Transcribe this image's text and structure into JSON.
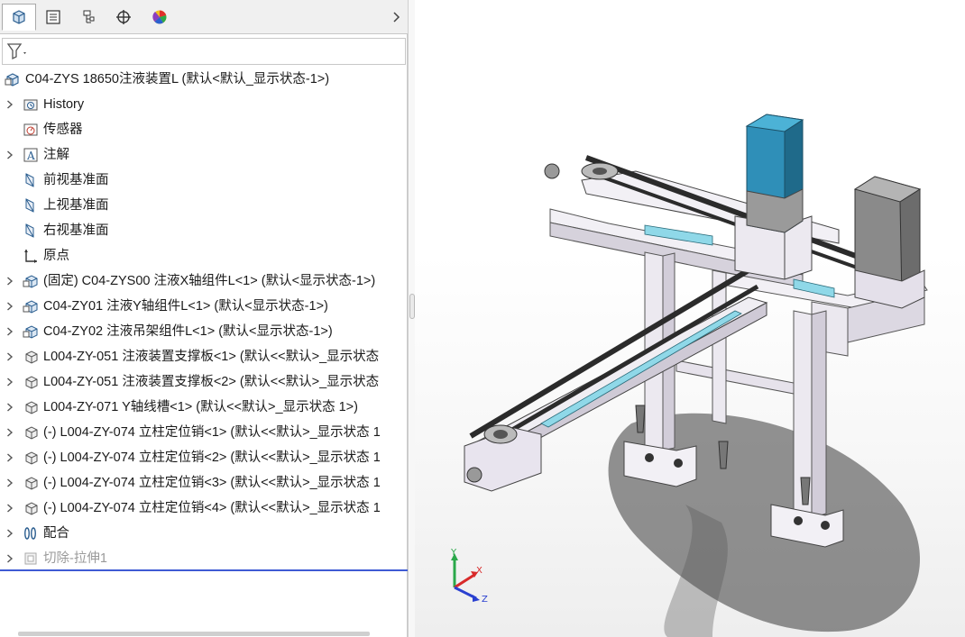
{
  "feature_tree": {
    "tabs": [
      {
        "icon": "feature-manager-icon",
        "active": true
      },
      {
        "icon": "property-manager-icon",
        "active": false
      },
      {
        "icon": "configuration-manager-icon",
        "active": false
      },
      {
        "icon": "dimxpert-icon",
        "active": false
      },
      {
        "icon": "display-manager-icon",
        "active": false
      }
    ],
    "filter_icon": "filter-icon",
    "root": {
      "label": "C04-ZYS 18650注液装置L  (默认<默认_显示状态-1>)",
      "icon": "assembly-icon"
    },
    "items": [
      {
        "label": "History",
        "icon": "history-folder-icon",
        "expandable": true
      },
      {
        "label": "传感器",
        "icon": "sensor-icon",
        "expandable": false
      },
      {
        "label": "注解",
        "icon": "annotation-icon",
        "expandable": true
      },
      {
        "label": "前视基准面",
        "icon": "plane-icon",
        "expandable": false
      },
      {
        "label": "上视基准面",
        "icon": "plane-icon",
        "expandable": false
      },
      {
        "label": "右视基准面",
        "icon": "plane-icon",
        "expandable": false
      },
      {
        "label": "原点",
        "icon": "origin-icon",
        "expandable": false
      },
      {
        "label": "(固定) C04-ZYS00 注液X轴组件L<1> (默认<显示状态-1>)",
        "icon": "subassembly-icon",
        "expandable": true
      },
      {
        "label": "C04-ZY01 注液Y轴组件L<1> (默认<显示状态-1>)",
        "icon": "subassembly-icon",
        "expandable": true
      },
      {
        "label": "C04-ZY02 注液吊架组件L<1> (默认<显示状态-1>)",
        "icon": "subassembly-icon",
        "expandable": true
      },
      {
        "label": "L004-ZY-051 注液装置支撑板<1> (默认<<默认>_显示状态",
        "icon": "part-icon",
        "expandable": true
      },
      {
        "label": "L004-ZY-051 注液装置支撑板<2> (默认<<默认>_显示状态",
        "icon": "part-icon",
        "expandable": true
      },
      {
        "label": "L004-ZY-071 Y轴线槽<1> (默认<<默认>_显示状态 1>)",
        "icon": "part-icon",
        "expandable": true
      },
      {
        "label": "(-) L004-ZY-074 立柱定位销<1> (默认<<默认>_显示状态 1",
        "icon": "part-icon",
        "expandable": true
      },
      {
        "label": "(-) L004-ZY-074 立柱定位销<2> (默认<<默认>_显示状态 1",
        "icon": "part-icon",
        "expandable": true
      },
      {
        "label": "(-) L004-ZY-074 立柱定位销<3> (默认<<默认>_显示状态 1",
        "icon": "part-icon",
        "expandable": true
      },
      {
        "label": "(-) L004-ZY-074 立柱定位销<4> (默认<<默认>_显示状态 1",
        "icon": "part-icon",
        "expandable": true
      },
      {
        "label": "配合",
        "icon": "mates-icon",
        "expandable": true
      },
      {
        "label": "切除-拉伸1",
        "icon": "cut-extrude-icon",
        "expandable": true,
        "suppressed": true
      }
    ]
  },
  "viewport": {
    "triad": {
      "x": "X",
      "y": "Y",
      "z": "Z"
    },
    "colors": {
      "motor_blue": "#2f8fb8",
      "motor_gray": "#8a8a8a",
      "frame": "#e8e4ee",
      "belt": "#2b2b2b",
      "rail_cyan": "#8fd8e8"
    }
  }
}
